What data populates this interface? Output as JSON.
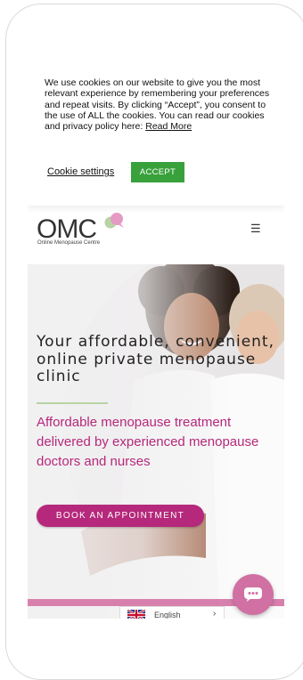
{
  "cookie": {
    "text": "We use cookies on our website to give you the most relevant experience by remembering your preferences and repeat visits. By clicking “Accept”, you consent to the use of ALL the cookies. You can read our cookies and privacy policy here: ",
    "read_more": "Read More",
    "settings_label": "Cookie settings",
    "accept_label": "ACCEPT"
  },
  "header": {
    "logo_text": "OMC",
    "logo_subtitle": "Online Menopause Centre",
    "menu_icon": "hamburger-icon"
  },
  "hero": {
    "title": "Your affordable, convenient, online private menopause clinic",
    "subtitle": "Affordable menopause treatment delivered by experienced menopause doctors and nurses",
    "cta_label": "BOOK AN APPOINTMENT"
  },
  "language": {
    "label": "English",
    "flag_icon": "uk-flag-icon"
  },
  "chat": {
    "icon": "chat-bubble-icon"
  },
  "colors": {
    "brand_pink": "#b5287b",
    "accept_green": "#39a13c",
    "chat_pink": "#d070a3",
    "divider_green": "#b9d3a4"
  }
}
